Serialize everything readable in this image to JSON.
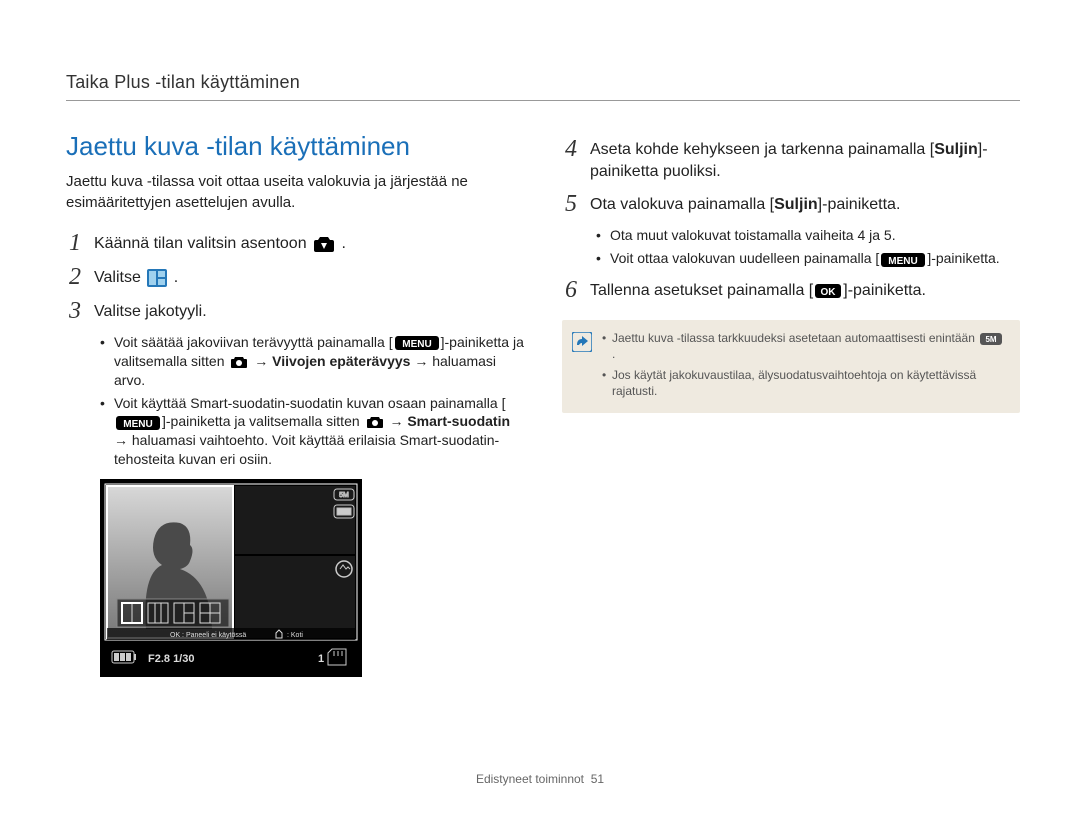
{
  "header": "Taika Plus -tilan käyttäminen",
  "title": "Jaettu kuva -tilan käyttäminen",
  "intro": "Jaettu kuva -tilassa voit ottaa useita valokuvia ja järjestää ne esimääritettyjen asettelujen avulla.",
  "steps_left": {
    "s1": "Käännä tilan valitsin asentoon",
    "s1_suffix": ".",
    "s2": "Valitse",
    "s2_suffix": ".",
    "s3": "Valitse jakotyyli."
  },
  "bullets_left": {
    "b1a": "Voit säätää jakoviivan terävyyttä painamalla [",
    "b1b": "]-painiketta ja valitsemalla sitten",
    "b1c": "→",
    "b1_strong": "Viivojen epäterävyys",
    "b1d": "→ haluamasi arvo.",
    "b2a": "Voit käyttää Smart-suodatin-suodatin kuvan osaan painamalla [",
    "b2b": "]-painiketta ja valitsemalla sitten",
    "b2c": "→",
    "b2_strong": "Smart-suodatin",
    "b2d": "→ haluamasi vaihtoehto. Voit käyttää erilaisia Smart-suodatin-tehosteita kuvan eri osiin."
  },
  "steps_right": {
    "s4a": "Aseta kohde kehykseen ja tarkenna painamalla [",
    "s4_strong": "Suljin",
    "s4b": "]-painiketta puoliksi.",
    "s5a": "Ota valokuva painamalla [",
    "s5_strong": "Suljin",
    "s5b": "]-painiketta.",
    "s6a": "Tallenna asetukset painamalla [",
    "s6b": "]-painiketta."
  },
  "bullets_right": {
    "b1": "Ota muut valokuvat toistamalla vaiheita 4 ja 5.",
    "b2a": "Voit ottaa valokuvan uudelleen painamalla [",
    "b2b": "]-painiketta."
  },
  "note": {
    "n1a": "Jaettu kuva -tilassa tarkkuudeksi asetetaan automaattisesti enintään",
    "n1b": ".",
    "n2": "Jos käytät jakokuvaustilaa, älysuodatusvaihtoehtoja on käytettävissä rajatusti."
  },
  "camera": {
    "ok_bar": "OK : Paneeli ei käytössä",
    "koti": ": Koti",
    "exposure": "F2.8 1/30",
    "shots": "1"
  },
  "footer": {
    "label": "Edistyneet toiminnot",
    "pagenum": "51"
  },
  "icons": {
    "menu": "MENU",
    "ok": "OK",
    "5m": "5M"
  }
}
